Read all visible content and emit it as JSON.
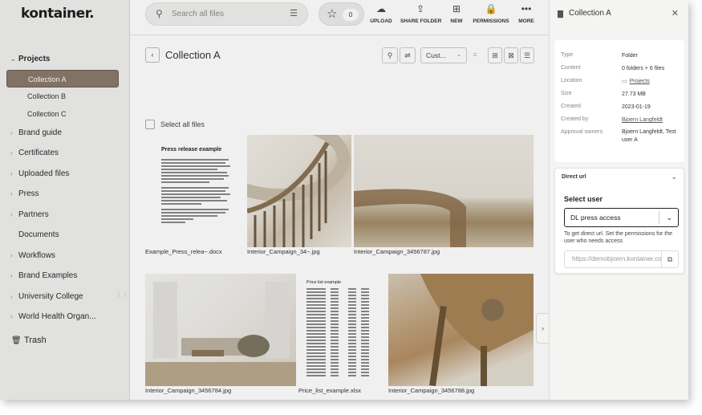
{
  "app": {
    "logo": "kontainer."
  },
  "sidebar": {
    "projects_label": "Projects",
    "collections": [
      "Collection A",
      "Collection B",
      "Collection C"
    ],
    "items": [
      "Brand guide",
      "Certificates",
      "Uploaded files",
      "Press",
      "Partners",
      "Documents",
      "Workflows",
      "Brand Examples",
      "University College",
      "World Health Organ..."
    ],
    "trash_label": "Trash"
  },
  "toolbar": {
    "search_placeholder": "Search all files",
    "favorites_count": "0",
    "actions": [
      "UPLOAD",
      "SHARE FOLDER",
      "NEW",
      "PERMISSIONS",
      "MORE"
    ]
  },
  "main": {
    "title": "Collection A",
    "sort_label": "Cust...",
    "select_all_label": "Select all files",
    "doc_heading": "Press release example",
    "price_heading": "Price list example",
    "files": [
      "Example_Press_relea~.docx",
      "Interior_Campaign_34~.jpg",
      "Interior_Campaign_3456787.jpg",
      "Interior_Campaign_3456784.jpg",
      "Price_list_example.xlsx",
      "Interior_Campaign_3456788.jpg"
    ]
  },
  "panel": {
    "title": "Collection A",
    "info": [
      {
        "key": "Type",
        "value": "Folder"
      },
      {
        "key": "Content",
        "value": "0 folders + 6 files"
      },
      {
        "key": "Location",
        "value": "Projects"
      },
      {
        "key": "Size",
        "value": "27.73 MB"
      },
      {
        "key": "Created",
        "value": "2023-01-19"
      },
      {
        "key": "Created by",
        "value": "Bjoern Langfeldt"
      },
      {
        "key": "Approval owners",
        "value": "Bjoern Langfeldt, Test user A"
      }
    ],
    "direct_url": {
      "title": "Direct url",
      "select_label": "Select user",
      "selected_user": "DL press access",
      "help": "To get direct url. Set the permissions for the user who needs access",
      "url": "https://demobjoern.kontainer.com"
    }
  },
  "colors": {
    "active_nav_bg": "#8a7a6c",
    "sidebar_bg": "#f0f0ef",
    "panel_bg": "#f4f4f3"
  }
}
